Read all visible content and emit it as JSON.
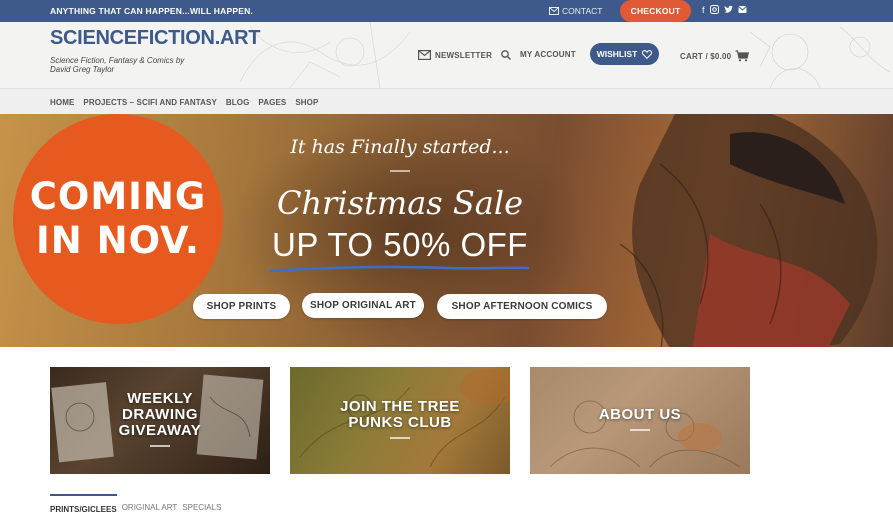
{
  "topbar": {
    "tagline": "ANYTHING THAT CAN HAPPEN...WILL HAPPEN.",
    "contact_label": "CONTACT",
    "checkout_label": "CHECKOUT",
    "socials": [
      "facebook-icon",
      "instagram-icon",
      "twitter-icon",
      "email-icon"
    ]
  },
  "header": {
    "logo": "SCIENCEFICTION.ART",
    "logo_sub": "Science Fiction, Fantasy & Comics by David Greg Taylor",
    "newsletter_label": "NEWSLETTER",
    "account_label": "MY ACCOUNT",
    "wishlist_label": "WISHLIST",
    "cart_label": "CART / $0.00"
  },
  "nav": {
    "items": [
      "HOME",
      "PROJECTS – SCIFI AND FANTASY",
      "BLOG",
      "PAGES",
      "SHOP"
    ]
  },
  "hero": {
    "badge_line1": "COMING",
    "badge_line2": "IN NOV.",
    "started": "It has Finally started...",
    "sale": "Christmas Sale",
    "off": "UP TO 50% OFF",
    "buttons": [
      "SHOP PRINTS",
      "SHOP ORIGINAL ART",
      "SHOP AFTERNOON COMICS"
    ]
  },
  "tiles": [
    {
      "line1": "WEEKLY",
      "line2": "DRAWING",
      "line3": "GIVEAWAY"
    },
    {
      "line1": "JOIN THE TREE",
      "line2": "PUNKS CLUB"
    },
    {
      "line1": "ABOUT US"
    }
  ],
  "tabs": [
    "PRINTS/GICLEES",
    "ORIGINAL ART",
    "SPECIALS"
  ],
  "colors": {
    "brand_blue": "#3d5a8a",
    "accent_orange": "#e05a36",
    "badge_orange": "#e65a1f"
  }
}
